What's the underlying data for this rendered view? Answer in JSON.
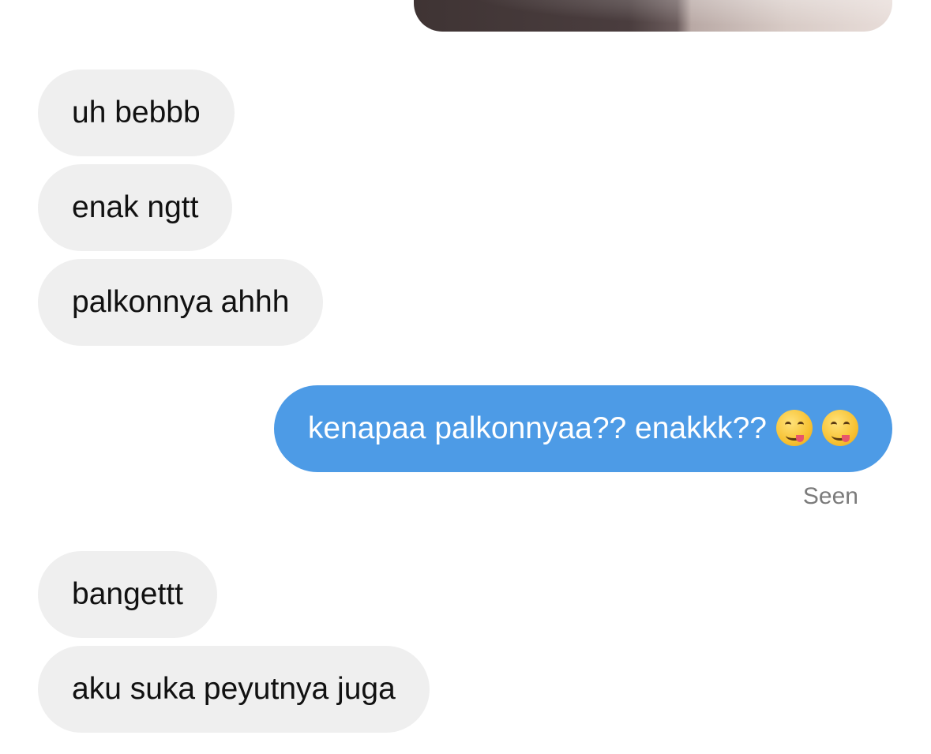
{
  "conversation": {
    "media_preview": {
      "icon": "photo-thumbnail"
    },
    "messages": [
      {
        "direction": "incoming",
        "text": "uh bebbb"
      },
      {
        "direction": "incoming",
        "text": "enak ngtt"
      },
      {
        "direction": "incoming",
        "text": "palkonnya ahhh"
      },
      {
        "direction": "outgoing",
        "text": "kenapaa palkonnyaa?? enakkk??",
        "emoji": [
          "face-savoring-food-emoji",
          "face-savoring-food-emoji"
        ]
      },
      {
        "direction": "incoming",
        "text": "bangettt"
      },
      {
        "direction": "incoming",
        "text": "aku suka peyutnya juga"
      }
    ],
    "read_receipt": "Seen"
  },
  "colors": {
    "incoming_bubble": "#efefef",
    "outgoing_bubble": "#4d9be6",
    "receipt_text": "#7b7b7b"
  }
}
